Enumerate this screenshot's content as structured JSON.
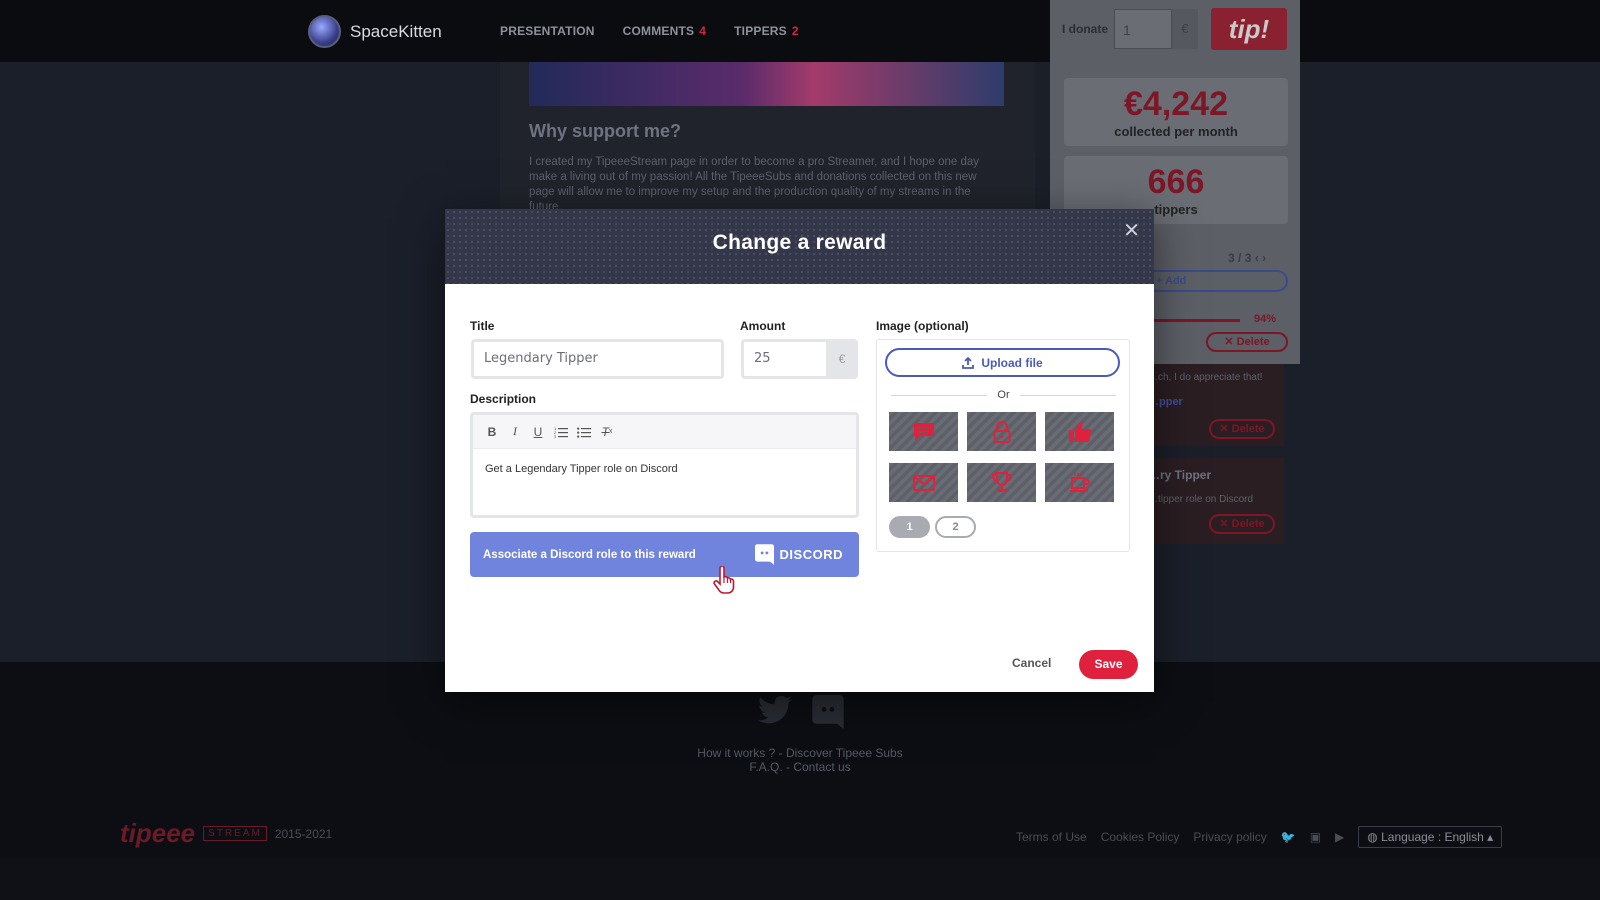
{
  "nav": {
    "brand": "SpaceKitten",
    "links": [
      {
        "label": "PRESENTATION",
        "count": ""
      },
      {
        "label": "COMMENTS",
        "count": "4"
      },
      {
        "label": "TIPPERS",
        "count": "2"
      }
    ]
  },
  "background": {
    "why_title": "Why support me?",
    "why_text": "I created my TipeeeStream page in order to become a pro Streamer, and I hope one day make a living out of my passion! All the TipeeeSubs and donations collected on this new page will allow me to improve my setup and the production quality of my streams in the future."
  },
  "side": {
    "donate_label": "I donate",
    "donate_value": "1",
    "currency": "€",
    "tip_label": "tip!",
    "stat1_value": "€4,242",
    "stat1_label": "collected per month",
    "stat2_value": "666",
    "stat2_label": "tippers",
    "pager_current": "3",
    "pager_total": "/ 3",
    "add_label": "Add",
    "progress_pct": "94%",
    "delete_label": "Delete",
    "reward2_text": "…ch, I do appreciate that!",
    "reward2_link": "…pper",
    "reward3_title": "…ry Tipper",
    "reward3_text": "…tipper role on Discord"
  },
  "modal": {
    "title": "Change a reward",
    "title_label": "Title",
    "title_value": "Legendary Tipper",
    "amount_label": "Amount",
    "amount_value": "25",
    "currency": "€",
    "description_label": "Description",
    "description_value": "Get a Legendary Tipper role on Discord",
    "discord_bar_text": "Associate a Discord role to this reward",
    "discord_logo_text": "DISCORD",
    "image_label": "Image (optional)",
    "upload_label": "Upload file",
    "or_label": "Or",
    "image_icons": [
      "chat-icon",
      "lock-icon",
      "thumbs-up-icon",
      "envelope-icon",
      "trophy-icon",
      "coffee-icon"
    ],
    "pages": [
      "1",
      "2"
    ],
    "cancel_label": "Cancel",
    "save_label": "Save"
  },
  "footer": {
    "links_line1": "How it works ? - Discover Tipeee Subs",
    "links_line2": "F.A.Q. - Contact us",
    "logo_tip": "tipeee",
    "logo_stream": "STREAM",
    "years": "2015-2021",
    "terms": "Terms of Use",
    "cookies": "Cookies Policy",
    "privacy": "Privacy policy",
    "language": "Language : English"
  },
  "colors": {
    "accent": "#e0213e",
    "discord": "#7084dd",
    "upload": "#4a5bb8",
    "modal_header": "#34374a"
  }
}
